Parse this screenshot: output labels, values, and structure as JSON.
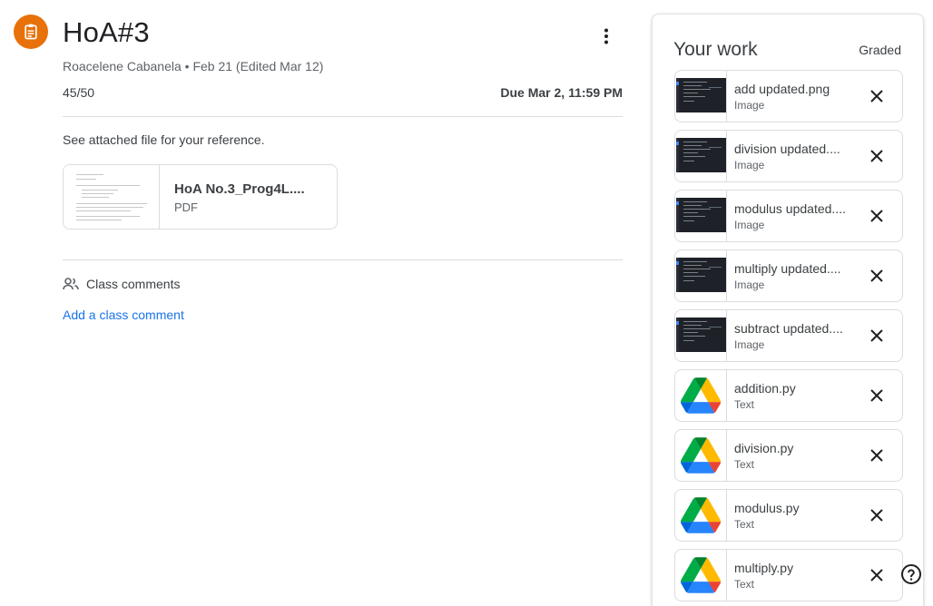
{
  "assignment": {
    "icon": "assignment-icon",
    "accent_color": "#e8710a",
    "title": "HoA#3",
    "author": "Roacelene Cabanela",
    "date": "Feb 21 (Edited Mar 12)",
    "points": "45/50",
    "due": "Due Mar 2, 11:59 PM",
    "description": "See attached file for your reference.",
    "attachment": {
      "name": "HoA No.3_Prog4L....",
      "type": "PDF"
    }
  },
  "comments": {
    "icon": "people-icon",
    "heading": "Class comments",
    "add_label": "Add a class comment"
  },
  "your_work": {
    "title": "Your work",
    "status": "Graded",
    "files": [
      {
        "name": "add updated.png",
        "type": "Image",
        "thumb": "screenshot"
      },
      {
        "name": "division updated....",
        "type": "Image",
        "thumb": "screenshot"
      },
      {
        "name": "modulus updated....",
        "type": "Image",
        "thumb": "screenshot"
      },
      {
        "name": "multiply updated....",
        "type": "Image",
        "thumb": "screenshot"
      },
      {
        "name": "subtract updated....",
        "type": "Image",
        "thumb": "screenshot"
      },
      {
        "name": "addition.py",
        "type": "Text",
        "thumb": "google-drive-icon"
      },
      {
        "name": "division.py",
        "type": "Text",
        "thumb": "google-drive-icon"
      },
      {
        "name": "modulus.py",
        "type": "Text",
        "thumb": "google-drive-icon"
      },
      {
        "name": "multiply.py",
        "type": "Text",
        "thumb": "google-drive-icon"
      }
    ]
  },
  "help": {
    "icon": "help-icon"
  }
}
